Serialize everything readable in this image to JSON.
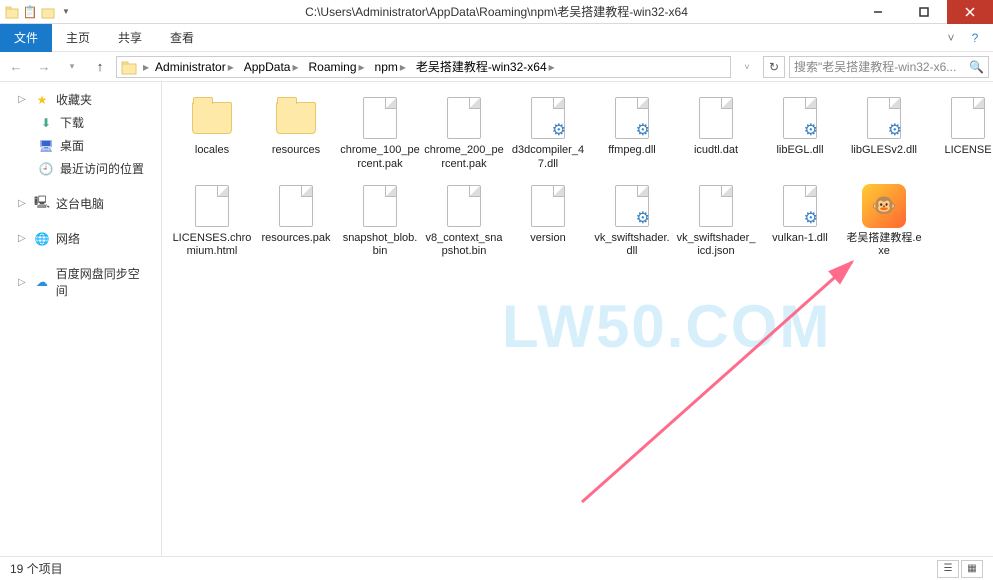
{
  "title": "C:\\Users\\Administrator\\AppData\\Roaming\\npm\\老吴搭建教程-win32-x64",
  "ribbon": {
    "tabs": [
      "文件",
      "主页",
      "共享",
      "查看"
    ],
    "active_index": 0
  },
  "breadcrumb": {
    "segments": [
      "Administrator",
      "AppData",
      "Roaming",
      "npm",
      "老吴搭建教程-win32-x64"
    ]
  },
  "search": {
    "placeholder": "搜索\"老吴搭建教程-win32-x6..."
  },
  "sidebar": {
    "favorites_label": "收藏夹",
    "items": [
      {
        "icon": "download",
        "label": "下载"
      },
      {
        "icon": "desktop",
        "label": "桌面"
      },
      {
        "icon": "recent",
        "label": "最近访问的位置"
      }
    ],
    "computer_label": "这台电脑",
    "network_label": "网络",
    "baidu_label": "百度网盘同步空间"
  },
  "files": [
    {
      "name": "locales",
      "type": "folder"
    },
    {
      "name": "resources",
      "type": "folder"
    },
    {
      "name": "chrome_100_percent.pak",
      "type": "file"
    },
    {
      "name": "chrome_200_percent.pak",
      "type": "file"
    },
    {
      "name": "d3dcompiler_47.dll",
      "type": "gear"
    },
    {
      "name": "ffmpeg.dll",
      "type": "gear"
    },
    {
      "name": "icudtl.dat",
      "type": "file"
    },
    {
      "name": "libEGL.dll",
      "type": "gear"
    },
    {
      "name": "libGLESv2.dll",
      "type": "gear"
    },
    {
      "name": "LICENSE",
      "type": "file"
    },
    {
      "name": "LICENSES.chromium.html",
      "type": "file"
    },
    {
      "name": "resources.pak",
      "type": "file"
    },
    {
      "name": "snapshot_blob.bin",
      "type": "file"
    },
    {
      "name": "v8_context_snapshot.bin",
      "type": "file"
    },
    {
      "name": "version",
      "type": "file"
    },
    {
      "name": "vk_swiftshader.dll",
      "type": "gear"
    },
    {
      "name": "vk_swiftshader_icd.json",
      "type": "file"
    },
    {
      "name": "vulkan-1.dll",
      "type": "gear"
    },
    {
      "name": "老吴搭建教程.exe",
      "type": "exe"
    }
  ],
  "status": {
    "count_text": "19 个项目"
  },
  "watermark": "LW50.COM"
}
